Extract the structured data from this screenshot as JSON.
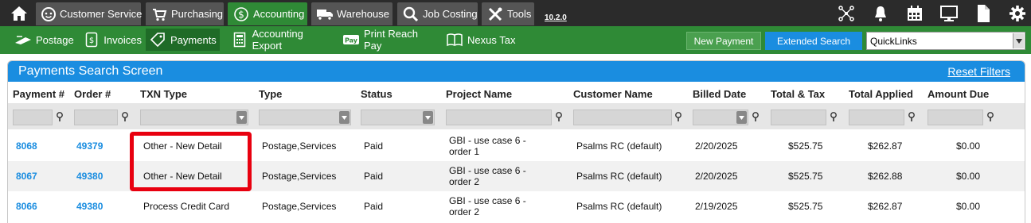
{
  "topnav": {
    "tabs": [
      {
        "label": "Customer Service",
        "icon": "customer-service-icon"
      },
      {
        "label": "Purchasing",
        "icon": "cart-icon"
      },
      {
        "label": "Accounting",
        "icon": "dollar-icon"
      },
      {
        "label": "Warehouse",
        "icon": "truck-icon"
      },
      {
        "label": "Job Costing",
        "icon": "magnifier-icon"
      },
      {
        "label": "Tools",
        "icon": "tools-icon"
      }
    ],
    "active_tab": "Accounting",
    "version": "10.2.0",
    "right_icons": [
      "network-icon",
      "bell-icon",
      "calendar-icon",
      "monitor-icon",
      "document-icon",
      "gear-icon"
    ]
  },
  "subnav": {
    "items": [
      {
        "label": "Postage",
        "icon": "postage-icon"
      },
      {
        "label": "Invoices",
        "icon": "invoice-icon"
      },
      {
        "label": "Payments",
        "icon": "tag-icon"
      },
      {
        "label": "Accounting Export",
        "icon": "calculator-icon"
      },
      {
        "label": "Print Reach Pay",
        "icon": "pay-icon"
      },
      {
        "label": "Nexus Tax",
        "icon": "book-icon"
      }
    ],
    "active_item": "Payments",
    "new_payment_label": "New Payment",
    "extended_search_label": "Extended Search",
    "quicklinks_value": "QuickLinks"
  },
  "panel": {
    "title": "Payments Search Screen",
    "reset_label": "Reset Filters"
  },
  "table": {
    "columns": [
      "Payment #",
      "Order #",
      "TXN Type",
      "Type",
      "Status",
      "Project Name",
      "Customer Name",
      "Billed Date",
      "Total & Tax",
      "Total Applied",
      "Amount Due"
    ],
    "rows": [
      {
        "payment": "8068",
        "order": "49379",
        "txn_type": "Other - New Detail",
        "type": "Postage,Services",
        "status": "Paid",
        "project": "GBI - use case 6 - order 1",
        "customer": "Psalms RC (default)",
        "billed": "2/20/2025",
        "total_tax": "$525.75",
        "total_applied": "$262.87",
        "amount_due": "$0.00"
      },
      {
        "payment": "8067",
        "order": "49380",
        "txn_type": "Other - New Detail",
        "type": "Postage,Services",
        "status": "Paid",
        "project": "GBI - use case 6 - order 2",
        "customer": "Psalms RC (default)",
        "billed": "2/20/2025",
        "total_tax": "$525.75",
        "total_applied": "$262.88",
        "amount_due": "$0.00"
      },
      {
        "payment": "8066",
        "order": "49380",
        "txn_type": "Process Credit Card",
        "type": "Postage,Services",
        "status": "Paid",
        "project": "GBI - use case 6 - order 2",
        "customer": "Psalms RC (default)",
        "billed": "2/19/2025",
        "total_tax": "$525.75",
        "total_applied": "$262.87",
        "amount_due": "$0.00"
      }
    ]
  },
  "colors": {
    "topbar_bg": "#2b2b2b",
    "green": "#2f8a36",
    "blue": "#1a8de0",
    "highlight": "#e8000f"
  }
}
